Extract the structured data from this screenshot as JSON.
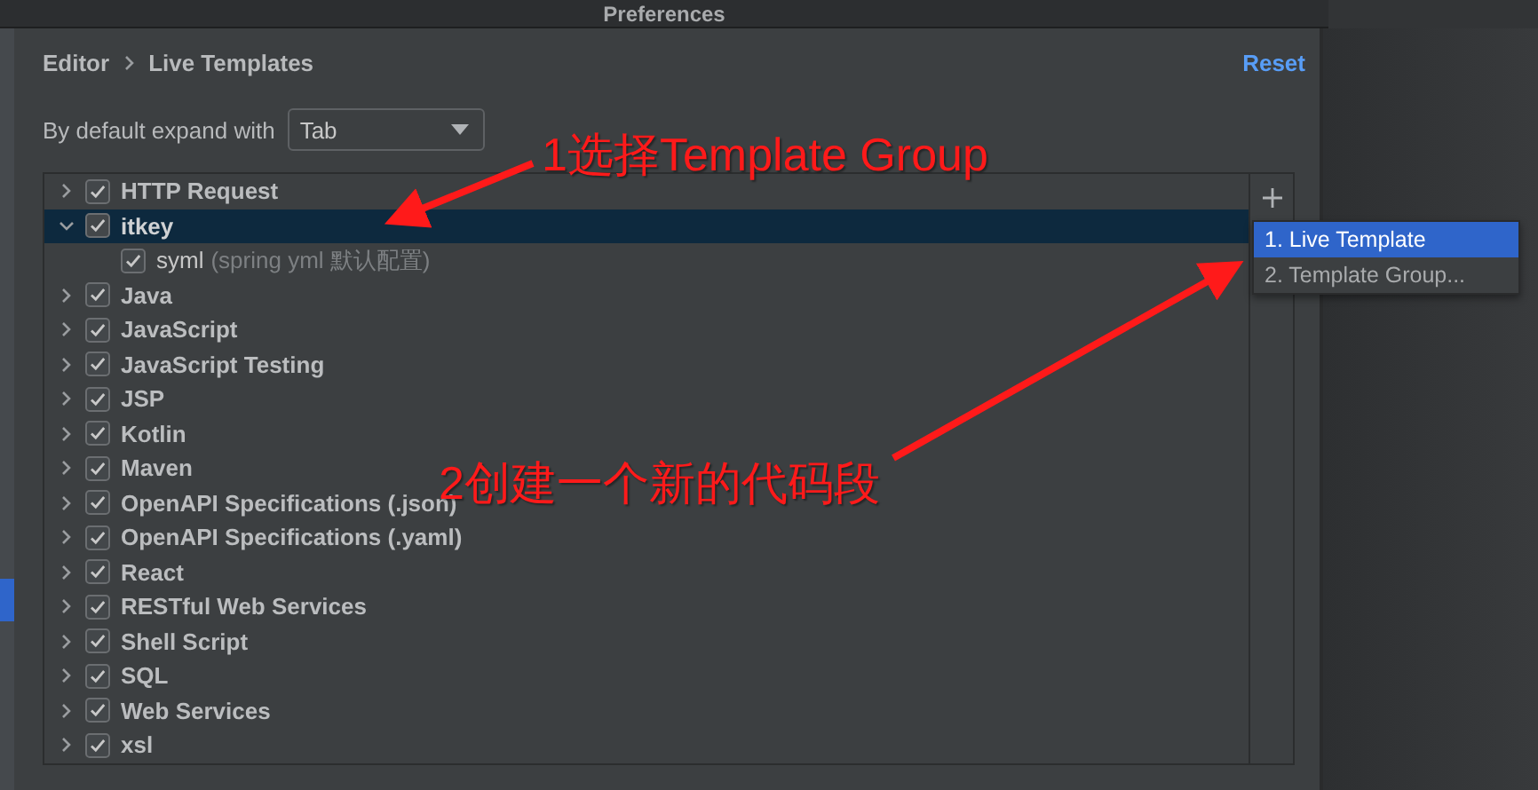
{
  "window": {
    "title": "Preferences"
  },
  "breadcrumb": [
    "Editor",
    "Live Templates"
  ],
  "reset_link": "Reset",
  "expand_setting": {
    "label": "By default expand with",
    "value": "Tab"
  },
  "template_groups": [
    {
      "name": "HTTP Request",
      "checked": true,
      "expanded": false,
      "selected": false
    },
    {
      "name": "itkey",
      "checked": true,
      "expanded": true,
      "selected": true,
      "children": [
        {
          "name": "syml",
          "description": "(spring yml 默认配置)",
          "checked": true
        }
      ]
    },
    {
      "name": "Java",
      "checked": true,
      "expanded": false,
      "selected": false
    },
    {
      "name": "JavaScript",
      "checked": true,
      "expanded": false,
      "selected": false
    },
    {
      "name": "JavaScript Testing",
      "checked": true,
      "expanded": false,
      "selected": false
    },
    {
      "name": "JSP",
      "checked": true,
      "expanded": false,
      "selected": false
    },
    {
      "name": "Kotlin",
      "checked": true,
      "expanded": false,
      "selected": false
    },
    {
      "name": "Maven",
      "checked": true,
      "expanded": false,
      "selected": false
    },
    {
      "name": "OpenAPI Specifications (.json)",
      "checked": true,
      "expanded": false,
      "selected": false
    },
    {
      "name": "OpenAPI Specifications (.yaml)",
      "checked": true,
      "expanded": false,
      "selected": false
    },
    {
      "name": "React",
      "checked": true,
      "expanded": false,
      "selected": false
    },
    {
      "name": "RESTful Web Services",
      "checked": true,
      "expanded": false,
      "selected": false
    },
    {
      "name": "Shell Script",
      "checked": true,
      "expanded": false,
      "selected": false
    },
    {
      "name": "SQL",
      "checked": true,
      "expanded": false,
      "selected": false
    },
    {
      "name": "Web Services",
      "checked": true,
      "expanded": false,
      "selected": false
    },
    {
      "name": "xsl",
      "checked": true,
      "expanded": false,
      "selected": false
    }
  ],
  "add_menu": [
    {
      "label": "1. Live Template",
      "selected": true
    },
    {
      "label": "2. Template Group...",
      "selected": false
    }
  ],
  "annotations": [
    {
      "text": "1选择Template Group"
    },
    {
      "text": "2创建一个新的代码段"
    }
  ]
}
